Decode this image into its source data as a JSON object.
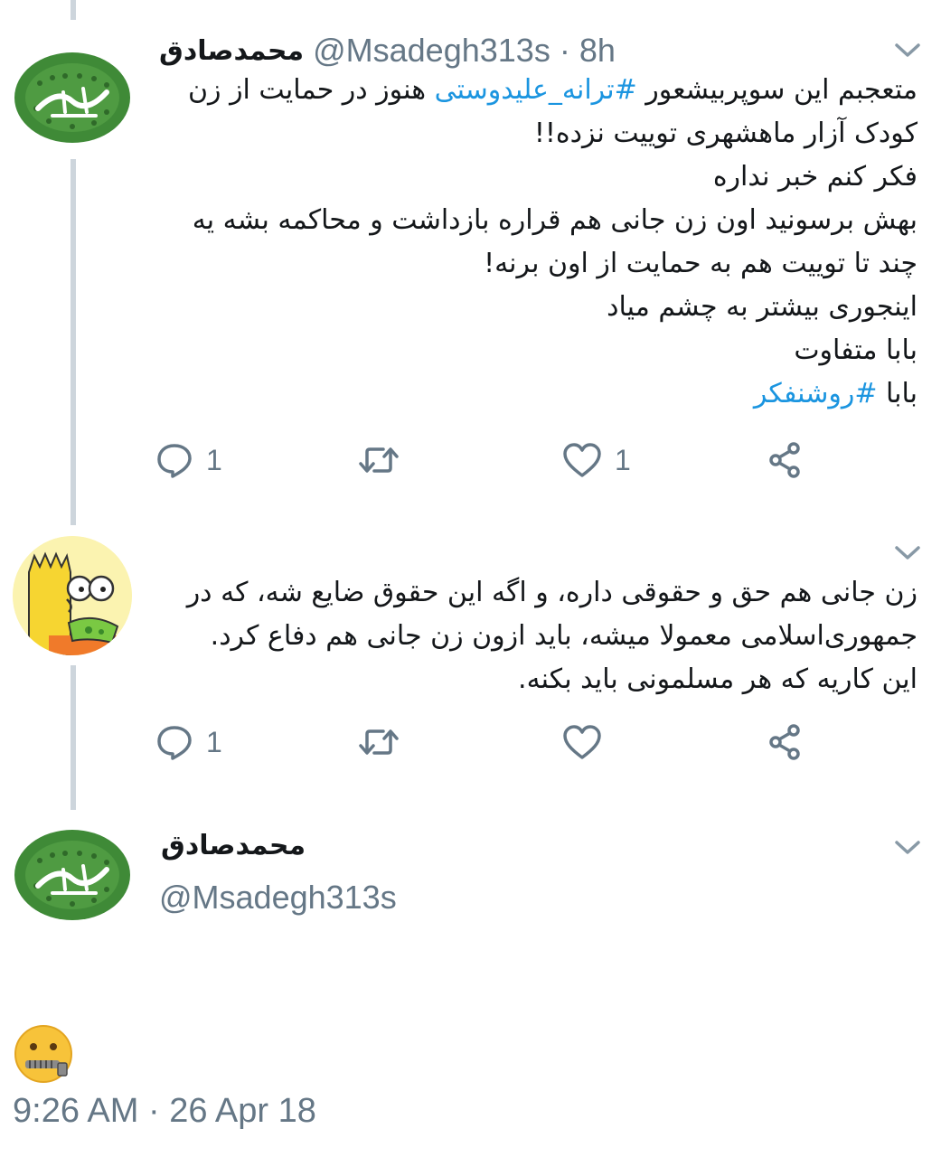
{
  "tweet1": {
    "name": "محمدصادق",
    "handle": "@Msadegh313s",
    "time": "8h",
    "lines": [
      {
        "a": "متعجبم این سوپربیشعور ",
        "tag": "#ترانه_علیدوستی",
        "b": " هنوز در حمایت از زن"
      },
      {
        "a": "کودک آزار ماهشهری توییت نزده!!",
        "tag": "",
        "b": ""
      },
      {
        "a": "فکر کنم خبر نداره",
        "tag": "",
        "b": ""
      },
      {
        "a": "بهش برسونید اون زن جانی هم قراره بازداشت و محاکمه بشه یه",
        "tag": "",
        "b": ""
      },
      {
        "a": "چند تا توییت هم به حمایت از اون برنه!",
        "tag": "",
        "b": ""
      },
      {
        "a": "اینجوری بیشتر به چشم میاد",
        "tag": "",
        "b": ""
      },
      {
        "a": "بابا متفاوت",
        "tag": "",
        "b": ""
      },
      {
        "a": "بابا ",
        "tag": "#روشنفکر",
        "b": ""
      }
    ],
    "reply_count": "1",
    "retweet_count": "",
    "like_count": "1"
  },
  "tweet2": {
    "lines": [
      "زن جانی هم حق و حقوقی داره، و اگه این حقوق ضایع شه، که در",
      "جمهوری‌اسلامی معمولا میشه، باید ازون زن جانی هم دفاع کرد.",
      "این کاریه که هر مسلمونی باید بکنه."
    ],
    "reply_count": "1",
    "retweet_count": "",
    "like_count": ""
  },
  "tweet3": {
    "name": "محمدصادق",
    "handle": "@Msadegh313s",
    "emoji": "zipper-mouth-face",
    "timestamp": "9:26 AM · 26 Apr 18"
  },
  "colors": {
    "link": "#1b95e0",
    "muted": "#657786",
    "thread": "#cdd5dc",
    "avatar_green": "#3f8a37"
  }
}
